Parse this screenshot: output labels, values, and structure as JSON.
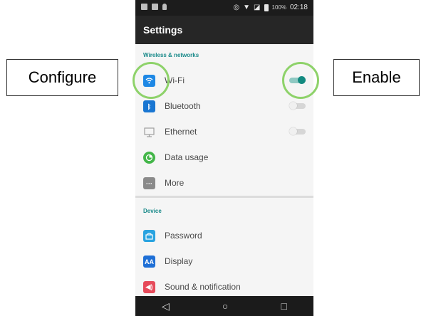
{
  "callouts": {
    "configure": "Configure",
    "enable": "Enable"
  },
  "status_bar": {
    "battery": "100%",
    "time": "02:18"
  },
  "app_bar": {
    "title": "Settings"
  },
  "sections": {
    "wireless": "Wireless & networks",
    "device": "Device"
  },
  "items": {
    "wifi": {
      "label": "Wi-Fi",
      "toggle_on": true,
      "color": "#1e88e5"
    },
    "bluetooth": {
      "label": "Bluetooth",
      "toggle_on": false,
      "color": "#1976d2"
    },
    "ethernet": {
      "label": "Ethernet",
      "toggle_on": false
    },
    "data_usage": {
      "label": "Data usage",
      "color": "#43b649"
    },
    "more": {
      "label": "More",
      "color": "#8a8a8a"
    },
    "password": {
      "label": "Password",
      "color": "#29a3e0"
    },
    "display": {
      "label": "Display",
      "color": "#1e6fd6",
      "icon_text": "AA"
    },
    "sound": {
      "label": "Sound & notification",
      "color": "#e64a5a"
    }
  },
  "nav": {
    "back": "◁",
    "home": "○",
    "recents": "□"
  },
  "highlight_color": "#8ed26a"
}
